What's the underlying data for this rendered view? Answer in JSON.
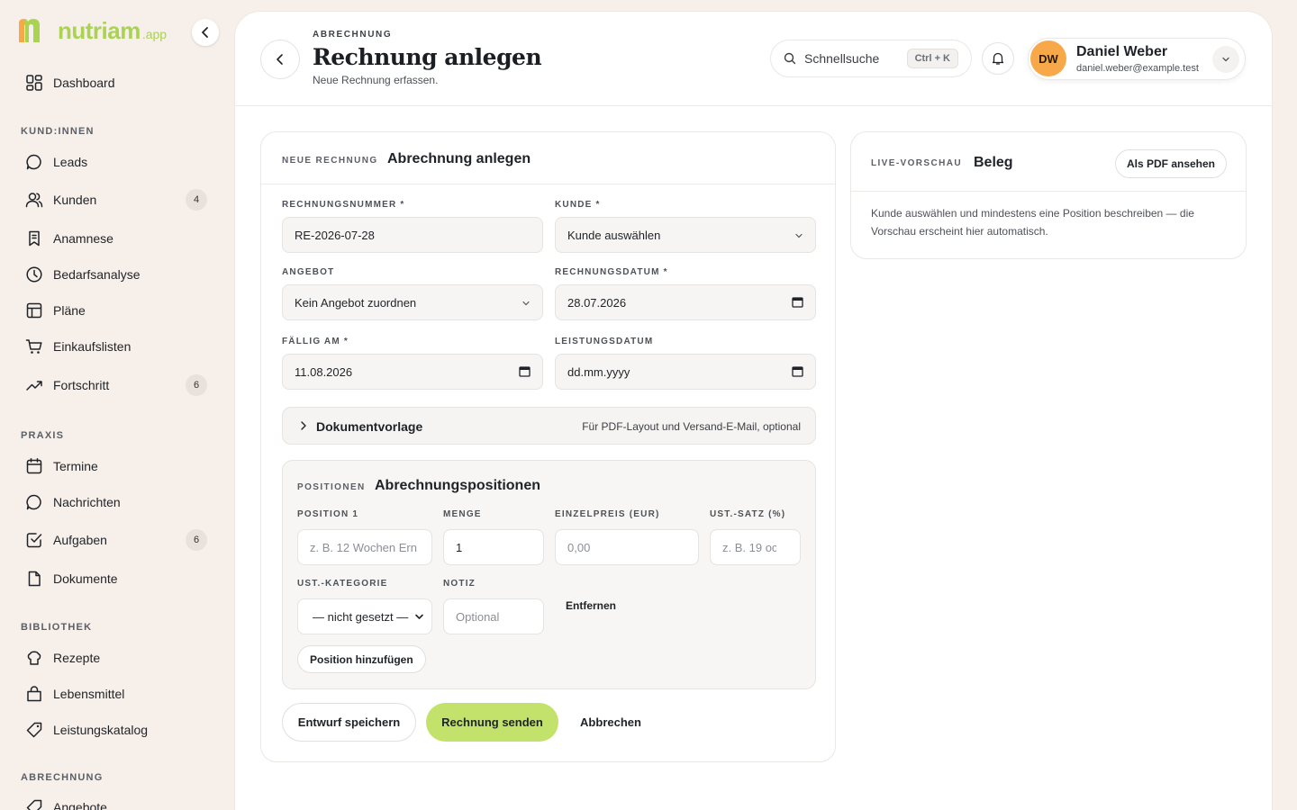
{
  "brand": {
    "name": "nutriam",
    "suffix": ".app",
    "accent": "#a9d350"
  },
  "sidebar": {
    "items": [
      {
        "label": "Dashboard"
      },
      {
        "label": "Leads"
      },
      {
        "label": "Kunden",
        "badge": "4"
      },
      {
        "label": "Anamnese"
      },
      {
        "label": "Bedarfsanalyse"
      },
      {
        "label": "Pläne"
      },
      {
        "label": "Einkaufslisten"
      },
      {
        "label": "Fortschritt",
        "badge": "6"
      },
      {
        "label": "Termine"
      },
      {
        "label": "Nachrichten"
      },
      {
        "label": "Aufgaben",
        "badge": "6"
      },
      {
        "label": "Dokumente"
      },
      {
        "label": "Rezepte"
      },
      {
        "label": "Lebensmittel"
      },
      {
        "label": "Leistungskatalog"
      },
      {
        "label": "Angebote"
      }
    ],
    "sections": [
      "KUND:INNEN",
      "PRAXIS",
      "BIBLIOTHEK",
      "ABRECHNUNG"
    ]
  },
  "header": {
    "eyebrow": "ABRECHNUNG",
    "title": "Rechnung anlegen",
    "subtitle": "Neue Rechnung erfassen.",
    "search_label": "Schnellsuche",
    "shortcut": "Ctrl + K"
  },
  "user": {
    "initials": "DW",
    "name": "Daniel Weber",
    "email": "daniel.weber@example.test"
  },
  "form": {
    "eyebrow": "NEUE RECHNUNG",
    "title": "Abrechnung anlegen",
    "fields": {
      "invoice_number": {
        "label": "RECHNUNGSNUMMER *",
        "value": "RE-2026-07-28"
      },
      "customer": {
        "label": "KUNDE *",
        "value": "Kunde auswählen"
      },
      "offer": {
        "label": "ANGEBOT",
        "value": "Kein Angebot zuordnen"
      },
      "invoice_date": {
        "label": "RECHNUNGSDATUM *",
        "value": "28.07.2026"
      },
      "due_date": {
        "label": "FÄLLIG AM *",
        "value": "11.08.2026"
      },
      "service_date": {
        "label": "LEISTUNGSDATUM",
        "value": "dd.mm.yyyy"
      }
    },
    "document_template": {
      "title": "Dokumentvorlage",
      "hint": "Für PDF-Layout und Versand-E-Mail, optional"
    },
    "positions": {
      "eyebrow": "POSITIONEN",
      "title": "Abrechnungspositionen",
      "labels": {
        "position": "POSITION 1",
        "quantity": "MENGE",
        "unit_price": "EINZELPREIS (EUR)",
        "vat_rate": "UST.-SATZ (%)",
        "vat_category": "UST.-KATEGORIE",
        "note": "NOTIZ"
      },
      "placeholders": {
        "position": "z. B. 12 Wochen Ern",
        "unit_price": "0,00",
        "vat_rate": "z. B. 19 oc",
        "note": "Optional"
      },
      "quantity_value": "1",
      "vat_category_value": "— nicht gesetzt —",
      "remove_label": "Entfernen",
      "add_label": "Position hinzufügen"
    },
    "actions": {
      "draft": "Entwurf speichern",
      "send": "Rechnung senden",
      "cancel": "Abbrechen"
    }
  },
  "preview": {
    "eyebrow": "LIVE-VORSCHAU",
    "title": "Beleg",
    "pdf_button": "Als PDF ansehen",
    "text": "Kunde auswählen und mindestens eine Position beschreiben — die Vorschau erscheint hier automatisch."
  }
}
